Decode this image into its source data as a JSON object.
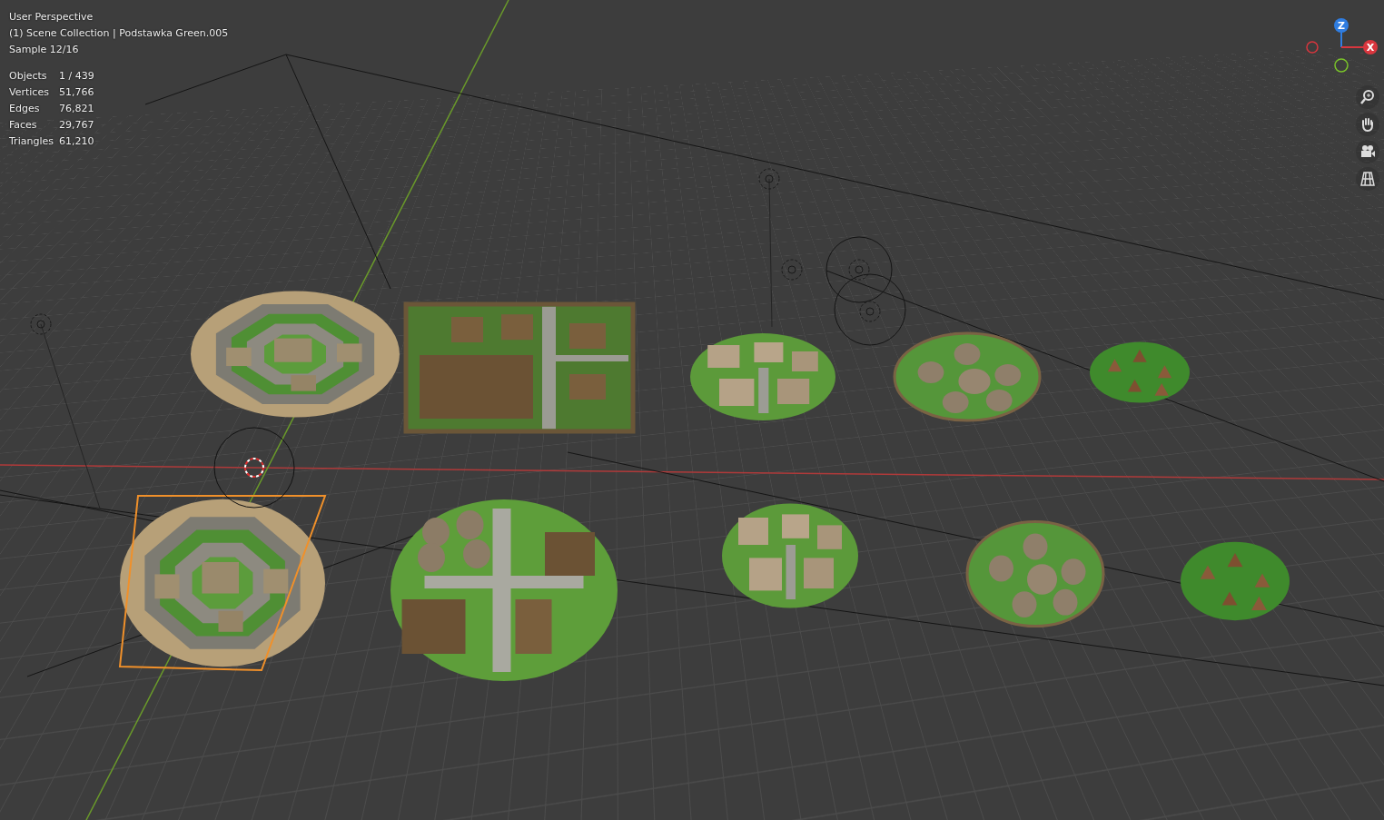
{
  "viewport": {
    "header": [
      "User Perspective",
      "(1) Scene Collection | Podstawka Green.005",
      "Sample 12/16"
    ]
  },
  "stats": [
    {
      "label": "Objects",
      "value": "1 / 439"
    },
    {
      "label": "Vertices",
      "value": "51,766"
    },
    {
      "label": "Edges",
      "value": "76,821"
    },
    {
      "label": "Faces",
      "value": "29,767"
    },
    {
      "label": "Triangles",
      "value": "61,210"
    }
  ],
  "gizmo": {
    "z": "Z",
    "x": "X"
  },
  "models": [
    {
      "kind": "fort",
      "selected": false
    },
    {
      "kind": "palisade",
      "selected": false
    },
    {
      "kind": "adobe",
      "selected": false
    },
    {
      "kind": "huts",
      "selected": false
    },
    {
      "kind": "tents",
      "selected": false
    },
    {
      "kind": "fort",
      "selected": true
    },
    {
      "kind": "village",
      "selected": false
    },
    {
      "kind": "adobe",
      "selected": false
    },
    {
      "kind": "huts",
      "selected": false
    },
    {
      "kind": "tents",
      "selected": false
    }
  ]
}
